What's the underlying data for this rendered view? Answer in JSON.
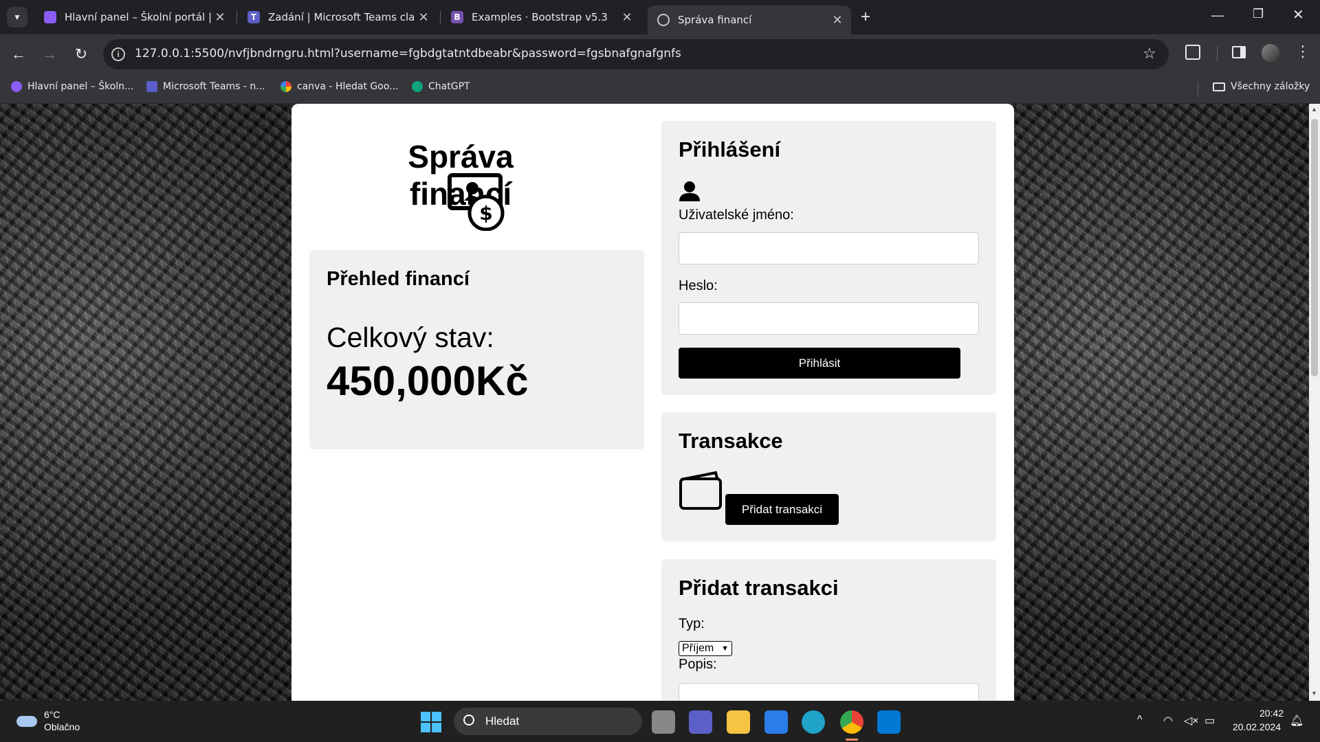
{
  "browser": {
    "tabs": [
      {
        "title": "Hlavní panel – Školní portál | htt",
        "icon_color": "#8a5cf6"
      },
      {
        "title": "Zadání | Microsoft Teams classic",
        "icon_color": "#5b5fc7"
      },
      {
        "title": "Examples · Bootstrap v5.3",
        "icon_color": "#7952b3",
        "icon_letter": "B"
      },
      {
        "title": "Správa financí",
        "icon_color": "#5f6368"
      }
    ],
    "new_tab": "+",
    "close": "✕",
    "url": "127.0.0.1:5500/nvfjbndrngru.html?username=fgbdgtatntdbeabr&password=fgsbnafgnafgnfs",
    "bookmarks": [
      {
        "label": "Hlavní panel – Školn...",
        "color": "#8a5cf6"
      },
      {
        "label": "Microsoft Teams - n...",
        "color": "#5b5fc7"
      },
      {
        "label": "canva - Hledat Goo...",
        "color": "#4285f4"
      },
      {
        "label": "ChatGPT",
        "color": "#10a37f"
      }
    ],
    "all_bookmarks": "Všechny záložky"
  },
  "page": {
    "app_title": "Správa financí",
    "overview": {
      "heading": "Přehled financí",
      "balance_label": "Celkový stav:",
      "balance_value": "450,000Kč"
    },
    "login": {
      "heading": "Přihlášení",
      "username_label": "Uživatelské jméno:",
      "username_value": "",
      "password_label": "Heslo:",
      "password_value": "",
      "submit": "Přihlásit"
    },
    "transactions": {
      "heading": "Transakce",
      "add_button": "Přidat transakci"
    },
    "add_transaction": {
      "heading": "Přidat transakci",
      "type_label": "Typ:",
      "type_selected": "Příjem",
      "description_label": "Popis:"
    }
  },
  "taskbar": {
    "weather_temp": "6°C",
    "weather_desc": "Oblačno",
    "search_placeholder": "Hledat",
    "time": "20:42",
    "date": "20.02.2024"
  }
}
